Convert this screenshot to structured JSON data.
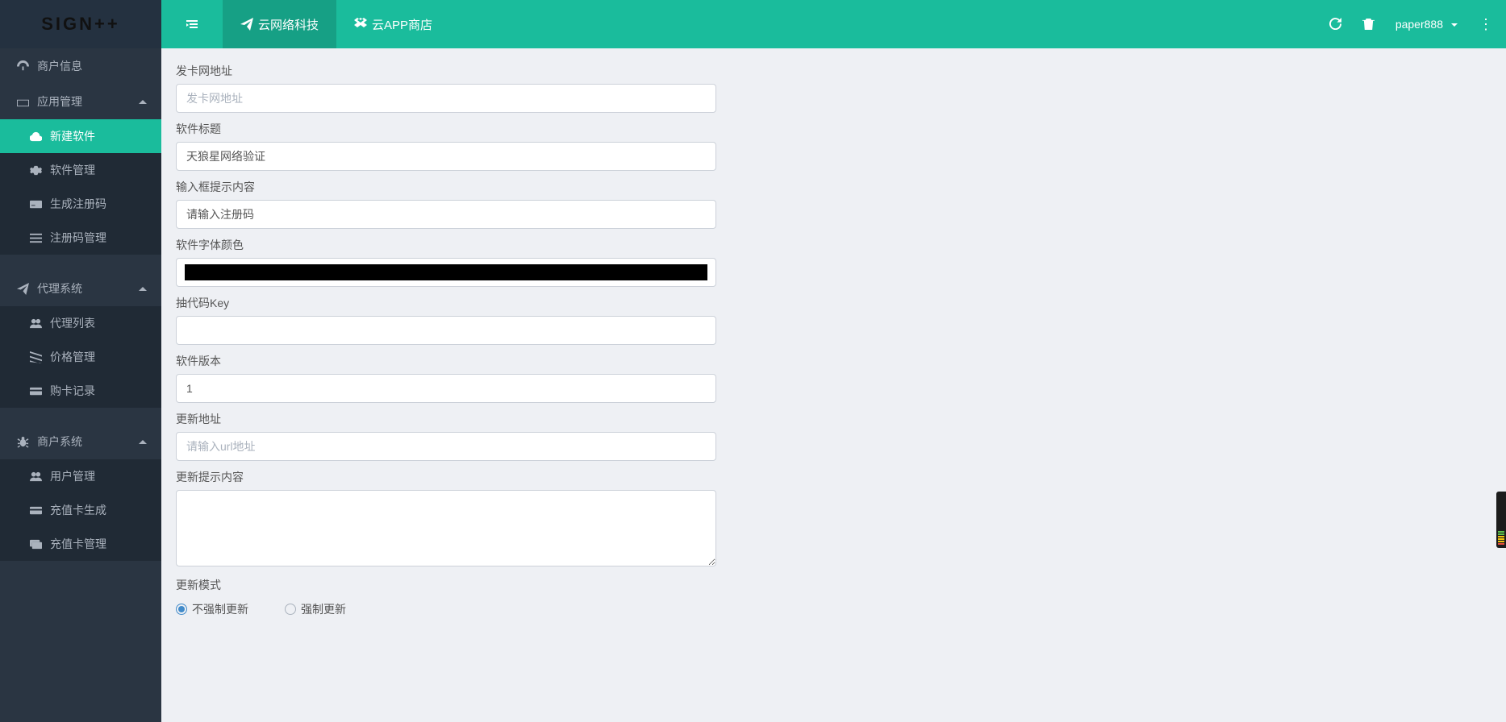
{
  "logo": "SIGN++",
  "topnav": {
    "item_cloud_network": "云网络科技",
    "item_app_store": "云APP商店"
  },
  "topright": {
    "username": "paper888"
  },
  "sidebar": {
    "merchant_info": "商户信息",
    "app_manage": "应用管理",
    "app_manage_children": {
      "new_software": "新建软件",
      "software_manage": "软件管理",
      "gen_reg_code": "生成注册码",
      "reg_code_manage": "注册码管理"
    },
    "agent_system": "代理系统",
    "agent_system_children": {
      "agent_list": "代理列表",
      "price_manage": "价格管理",
      "purchase_record": "购卡记录"
    },
    "merchant_system": "商户系统",
    "merchant_system_children": {
      "user_manage": "用户管理",
      "recharge_gen": "充值卡生成",
      "recharge_manage": "充值卡管理"
    }
  },
  "form": {
    "card_url_label": "发卡网地址",
    "card_url_placeholder": "发卡网地址",
    "title_label": "软件标题",
    "title_value": "天狼星网络验证",
    "input_hint_label": "输入框提示内容",
    "input_hint_value": "请输入注册码",
    "font_color_label": "软件字体颜色",
    "font_color_value": "#000000",
    "code_key_label": "抽代码Key",
    "code_key_value": "",
    "version_label": "软件版本",
    "version_value": "1",
    "update_url_label": "更新地址",
    "update_url_placeholder": "请输入url地址",
    "update_hint_label": "更新提示内容",
    "update_hint_value": "",
    "update_mode_label": "更新模式",
    "update_mode_opt_no": "不强制更新",
    "update_mode_opt_force": "强制更新"
  }
}
